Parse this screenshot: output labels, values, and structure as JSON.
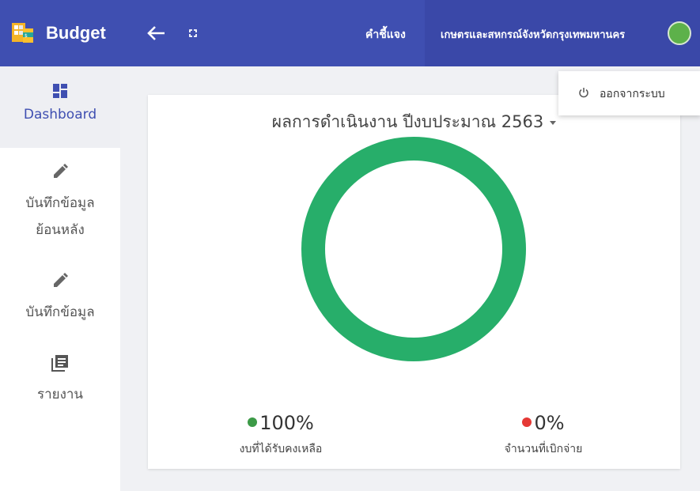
{
  "app": {
    "title": "Budget"
  },
  "header": {
    "explain_label": "คำชี้แจง",
    "user_name": "เกษตรและสหกรณ์จังหวัดกรุงเทพมหานคร"
  },
  "user_menu": {
    "logout_label": "ออกจากระบบ"
  },
  "sidebar": {
    "items": [
      {
        "label": "Dashboard",
        "icon": "dashboard-icon",
        "active": true
      },
      {
        "label": "บันทึกข้อมูล\nย้อนหลัง",
        "icon": "pencil-icon"
      },
      {
        "label": "บันทึกข้อมูล",
        "icon": "pencil-icon"
      },
      {
        "label": "รายงาน",
        "icon": "report-icon"
      }
    ]
  },
  "dashboard": {
    "select_label": "ผลการดำเนินงาน ปีงบประมาณ 2563",
    "stats": [
      {
        "value": "100%",
        "caption": "งบที่ได้รับคงเหลือ",
        "color": "#3c9a47"
      },
      {
        "value": "0%",
        "caption": "จำนวนที่เบิกจ่าย",
        "color": "#e53935"
      }
    ]
  },
  "chart_data": {
    "type": "pie",
    "categories": [
      "งบที่ได้รับคงเหลือ",
      "จำนวนที่เบิกจ่าย"
    ],
    "values": [
      100,
      0
    ],
    "colors": [
      "#27ae6a",
      "#e53935"
    ]
  },
  "colors": {
    "primary": "#3f4fb1",
    "donut": "#27ae6a"
  }
}
